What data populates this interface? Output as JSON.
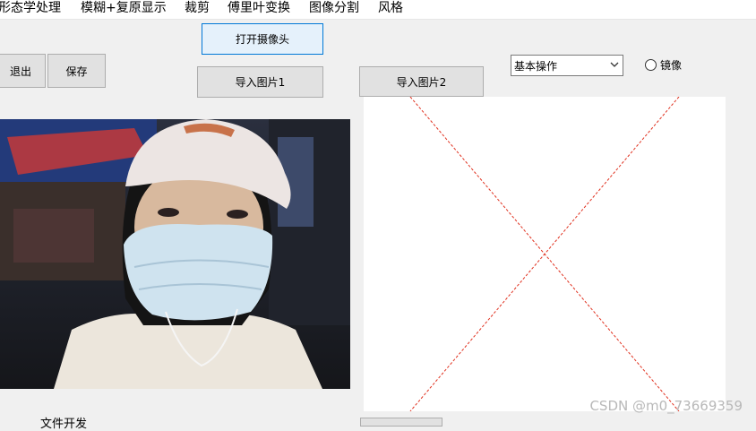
{
  "menu": [
    {
      "label": "形态学处理"
    },
    {
      "label": "模糊+复原显示"
    },
    {
      "label": "裁剪"
    },
    {
      "label": "傅里叶变换"
    },
    {
      "label": "图像分割"
    },
    {
      "label": "风格"
    }
  ],
  "buttons": {
    "open_camera": "打开摄像头",
    "exit": "退出",
    "save": "保存",
    "import1": "导入图片1",
    "import2": "导入图片2"
  },
  "operation_select": {
    "value": "基本操作"
  },
  "mirror_radio": {
    "label": "镜像",
    "checked": false
  },
  "bottom_label": "文件开发",
  "watermark": "CSDN @m0_73669359",
  "colors": {
    "placeholder_cross": "#e0301e",
    "default_button_border": "#0078d7"
  }
}
